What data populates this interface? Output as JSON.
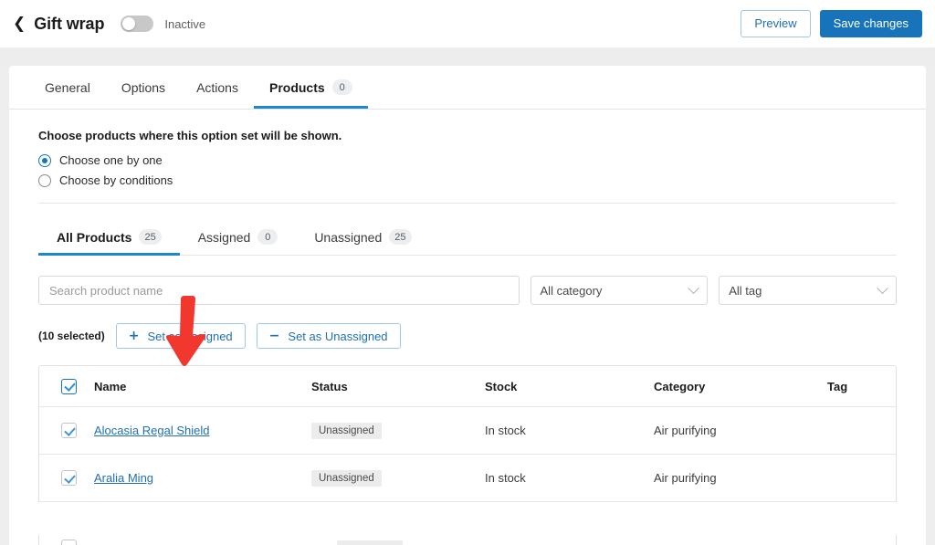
{
  "header": {
    "back_icon": "chevron-left-icon",
    "title": "Gift wrap",
    "toggle_state": "off",
    "toggle_label": "Inactive",
    "preview_label": "Preview",
    "save_label": "Save changes",
    "accent_color": "#1773ba"
  },
  "main_tabs": [
    {
      "label": "General",
      "badge": null,
      "active": false
    },
    {
      "label": "Options",
      "badge": null,
      "active": false
    },
    {
      "label": "Actions",
      "badge": null,
      "active": false
    },
    {
      "label": "Products",
      "badge": "0",
      "active": true
    }
  ],
  "scope_section": {
    "title": "Choose products where this option set will be shown.",
    "options": [
      {
        "label": "Choose one by one",
        "selected": true
      },
      {
        "label": "Choose by conditions",
        "selected": false
      }
    ]
  },
  "sub_tabs": [
    {
      "label": "All Products",
      "count": "25",
      "active": true
    },
    {
      "label": "Assigned",
      "count": "0",
      "active": false
    },
    {
      "label": "Unassigned",
      "count": "25",
      "active": false
    }
  ],
  "filters": {
    "search_placeholder": "Search product name",
    "search_value": "",
    "category_select": "All category",
    "tag_select": "All tag",
    "chevron_icon": "chevron-down-icon"
  },
  "bulk_actions": {
    "selected_text": "(10 selected)",
    "set_assigned_label": "Set as Assigned",
    "set_assigned_icon": "plus-icon",
    "set_unassigned_label": "Set as Unassigned",
    "set_unassigned_icon": "minus-icon"
  },
  "table": {
    "select_all_checked": true,
    "columns": [
      "Name",
      "Status",
      "Stock",
      "Category",
      "Tag"
    ],
    "rows": [
      {
        "checked": true,
        "name": "Alocasia Regal Shield",
        "status": "Unassigned",
        "stock": "In stock",
        "category": "Air purifying",
        "tag": ""
      },
      {
        "checked": true,
        "name": "Aralia Ming",
        "status": "Unassigned",
        "stock": "In stock",
        "category": "Air purifying",
        "tag": ""
      }
    ]
  },
  "annotation": {
    "arrow_icon": "down-arrow-annotation",
    "color": "#f2372f"
  }
}
